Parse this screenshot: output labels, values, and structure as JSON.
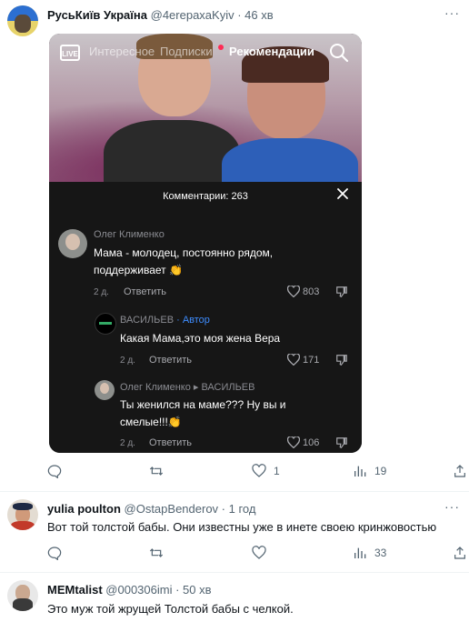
{
  "tweets": [
    {
      "name": "РусьКиїв Україна",
      "handle": "@4erepaxaKyiv",
      "time": "· 46 хв",
      "more_icon": "more-icon",
      "actions": {
        "replies": "",
        "retweets": "",
        "likes": "1",
        "views": "19"
      }
    },
    {
      "name": "yulia poulton",
      "handle": "@OstapBenderov",
      "time": "· 1 год",
      "text": "Вот той толстой бабы. Они известны уже в инете своею кринжовостью",
      "actions": {
        "replies": "",
        "retweets": "",
        "likes": "",
        "views": "33"
      }
    },
    {
      "name": "MEMtalist",
      "handle": "@000306imi",
      "time": "· 50 хв",
      "text": "Это муж той жрущей Толстой бабы с челкой."
    }
  ],
  "tiktok": {
    "live_label": "LIVE",
    "tabs": [
      "Интересное",
      "Подписки",
      "Рекомендации"
    ],
    "comments_title": "Комментарии: 263",
    "comments": [
      {
        "author": "Олег Клименко",
        "lines": [
          "Мама - молодец, постоянно рядом,",
          "поддерживает 👏"
        ],
        "date": "2 д.",
        "reply": "Ответить",
        "likes": "803"
      },
      {
        "author": "ВАСИЛЬЕВ",
        "badge": "· Автор",
        "lines": [
          "Какая Мама,это моя жена Вера"
        ],
        "date": "2 д.",
        "reply": "Ответить",
        "likes": "171"
      },
      {
        "author": "Олег Клименко ▸ ВАСИЛЬЕВ",
        "lines": [
          "Ты женился на маме??? Ну вы и",
          "смелые!!!👏"
        ],
        "date": "2 д.",
        "reply": "Ответить",
        "likes": "106"
      }
    ]
  },
  "colors": {
    "accent": "#1d9bf0",
    "muted": "#536471",
    "sheet": "#161616",
    "author_badge": "#3e8dff"
  }
}
